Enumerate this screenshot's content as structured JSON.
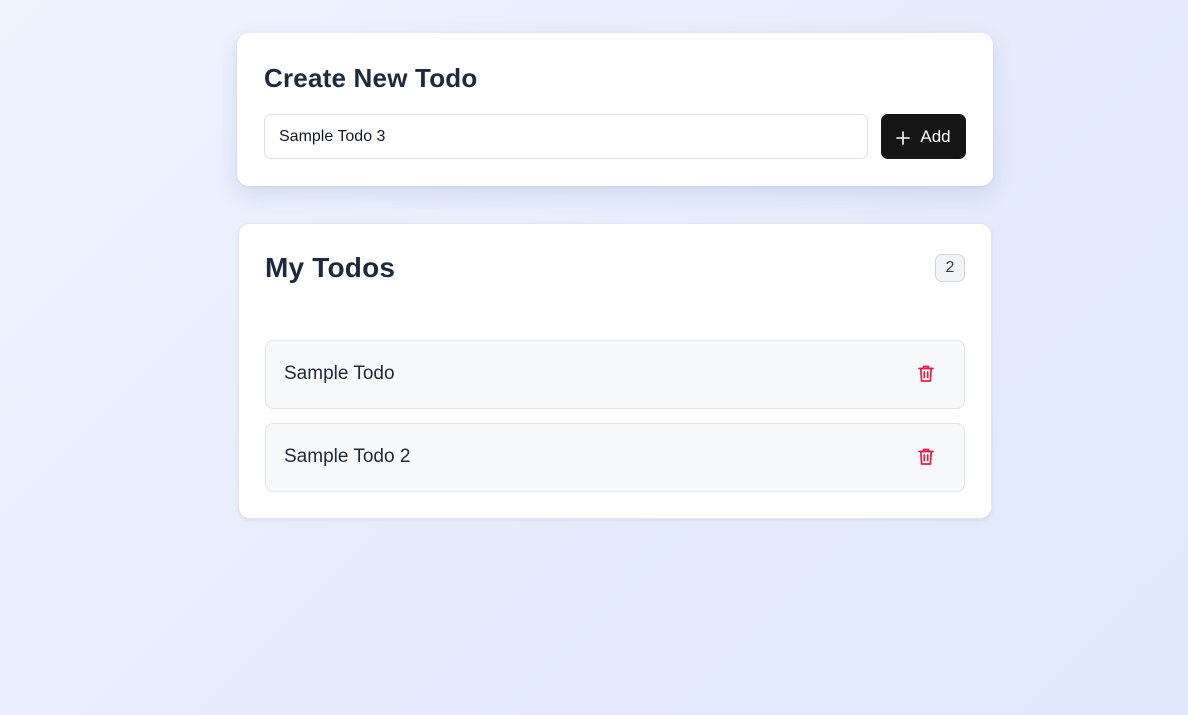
{
  "create": {
    "title": "Create New Todo",
    "input_value": "Sample Todo 3",
    "add_label": "Add",
    "add_icon": "plus-icon"
  },
  "list": {
    "title": "My Todos",
    "count": "2",
    "items": [
      {
        "text": "Sample Todo",
        "delete_icon": "trash-icon"
      },
      {
        "text": "Sample Todo 2",
        "delete_icon": "trash-icon"
      }
    ]
  },
  "colors": {
    "delete_icon": "#e11d48",
    "add_button_bg": "#151515"
  }
}
